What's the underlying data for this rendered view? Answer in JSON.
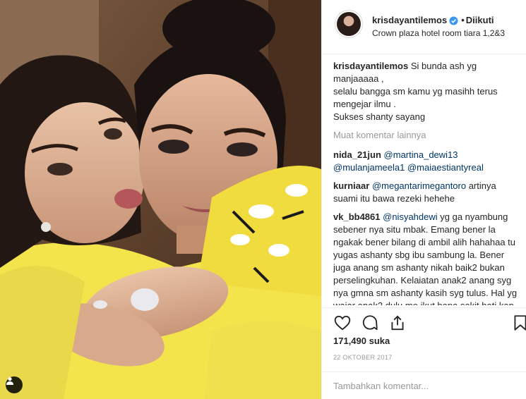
{
  "post": {
    "username": "krisdayantilemos",
    "separator": "•",
    "follow_status": "Diikuti",
    "location": "Crown plaza hotel room tiara 1,2&3",
    "caption_user": "krisdayantilemos",
    "caption_text": "Si bunda ash yg manjaaaaa ,\nselalu bangga sm kamu yg masihh terus mengejar ilmu .\nSukses shanty sayang",
    "load_more": "Muat komentar lainnya",
    "comments": [
      {
        "user": "nida_21jun",
        "mention1": "@martina_dewi13",
        "mention2": "@mulanjameela1",
        "mention3": "@maiaestiantyreal",
        "text": ""
      },
      {
        "user": "kurniaar",
        "mention1": "@megantarimegantoro",
        "text": " artinya suami itu bawa rezeki hehehe"
      },
      {
        "user": "vk_bb4861",
        "mention1": "@nisyahdewi",
        "text": " yg ga nyambung sebener nya situ mbak. Emang bener la ngakak bener bilang di ambil alih hahahaa tu yugas ashanty sbg ibu sambung la. Bener juga anang sm ashanty nikah baik2 bukan perselingkuhan. Kelaiatan anak2 anang syg nya gmna sm ashanty kasih syg tulus. Hal yg wajar anak2 dulu mo ikut bapa sakit hati kan liat depan mata emak dia"
      }
    ],
    "likes": "171,490 suka",
    "date": "22 OKTOBER 2017",
    "comment_placeholder": "Tambahkan komentar...",
    "icons": {
      "verified": "verified-badge-icon",
      "like": "heart-icon",
      "comment": "comment-bubble-icon",
      "share": "share-icon",
      "save": "bookmark-icon",
      "tag": "user-tag-icon"
    },
    "colors": {
      "verified": "#3897f0",
      "mention": "#003569",
      "muted": "#999999",
      "text": "#262626",
      "shirt_yellow": "#f2e44a"
    }
  }
}
